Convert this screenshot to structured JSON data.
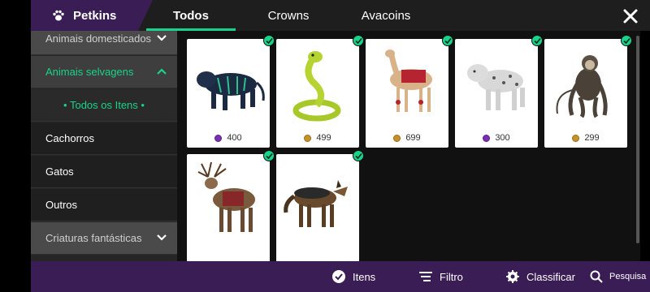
{
  "header": {
    "brand": "Petkins",
    "tabs": [
      {
        "label": "Todos",
        "active": true
      },
      {
        "label": "Crowns",
        "active": false
      },
      {
        "label": "Avacoins",
        "active": false
      }
    ]
  },
  "sidebar": {
    "categories": [
      {
        "label": "Animais domesticados",
        "expanded": false
      },
      {
        "label": "Animais selvagens",
        "expanded": true
      },
      {
        "label": "Criaturas fantásticas",
        "expanded": false
      }
    ],
    "subitems": [
      {
        "label": "•  Todos os Itens  •",
        "selected": true
      },
      {
        "label": "Cachorros"
      },
      {
        "label": "Gatos"
      },
      {
        "label": "Outros"
      }
    ]
  },
  "items": [
    {
      "animal": "tiger",
      "price": "400",
      "currency": "crowns",
      "owned": true
    },
    {
      "animal": "snake",
      "price": "499",
      "currency": "avacoins",
      "owned": true
    },
    {
      "animal": "camel",
      "price": "699",
      "currency": "avacoins",
      "owned": true
    },
    {
      "animal": "snow-leopard",
      "price": "300",
      "currency": "crowns",
      "owned": true
    },
    {
      "animal": "monkey",
      "price": "299",
      "currency": "avacoins",
      "owned": true
    },
    {
      "animal": "reindeer",
      "price": "",
      "currency": "",
      "owned": true
    },
    {
      "animal": "wolf",
      "price": "",
      "currency": "",
      "owned": true
    }
  ],
  "bottombar": {
    "itens": "Itens",
    "filtro": "Filtro",
    "classificar": "Classificar",
    "pesquisa": "Pesquisa"
  },
  "colors": {
    "accent": "#19d38a",
    "purple_bar": "#3a1d55",
    "crown_coin": "#7a2fb2",
    "avacoin": "#c8902a"
  }
}
